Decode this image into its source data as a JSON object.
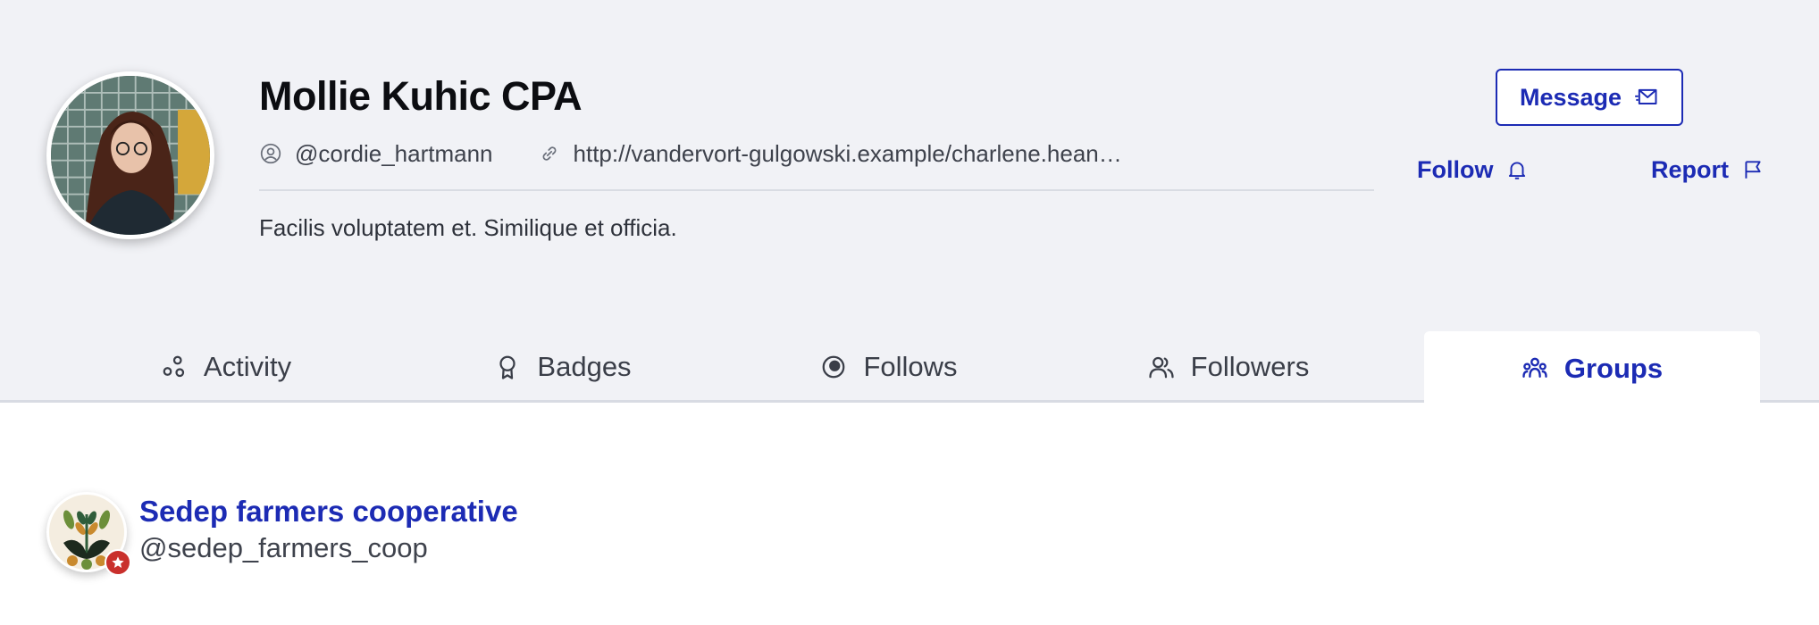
{
  "profile": {
    "name": "Mollie Kuhic CPA",
    "username": "@cordie_hartmann",
    "website": "http://vandervort-gulgowski.example/charlene.hean…",
    "bio": "Facilis voluptatem et. Similique et officia."
  },
  "actions": {
    "message_label": "Message",
    "follow_label": "Follow",
    "report_label": "Report"
  },
  "tabs": [
    {
      "label": "Activity",
      "icon": "activity-icon",
      "active": false
    },
    {
      "label": "Badges",
      "icon": "badge-icon",
      "active": false
    },
    {
      "label": "Follows",
      "icon": "follows-icon",
      "active": false
    },
    {
      "label": "Followers",
      "icon": "followers-icon",
      "active": false
    },
    {
      "label": "Groups",
      "icon": "groups-icon",
      "active": true
    }
  ],
  "groups": [
    {
      "name": "Sedep farmers cooperative",
      "handle": "@sedep_farmers_coop",
      "badge_icon": "star-icon"
    }
  ],
  "colors": {
    "accent": "#1c2bb4",
    "header_bg": "#f1f2f6",
    "badge": "#c9302c"
  }
}
